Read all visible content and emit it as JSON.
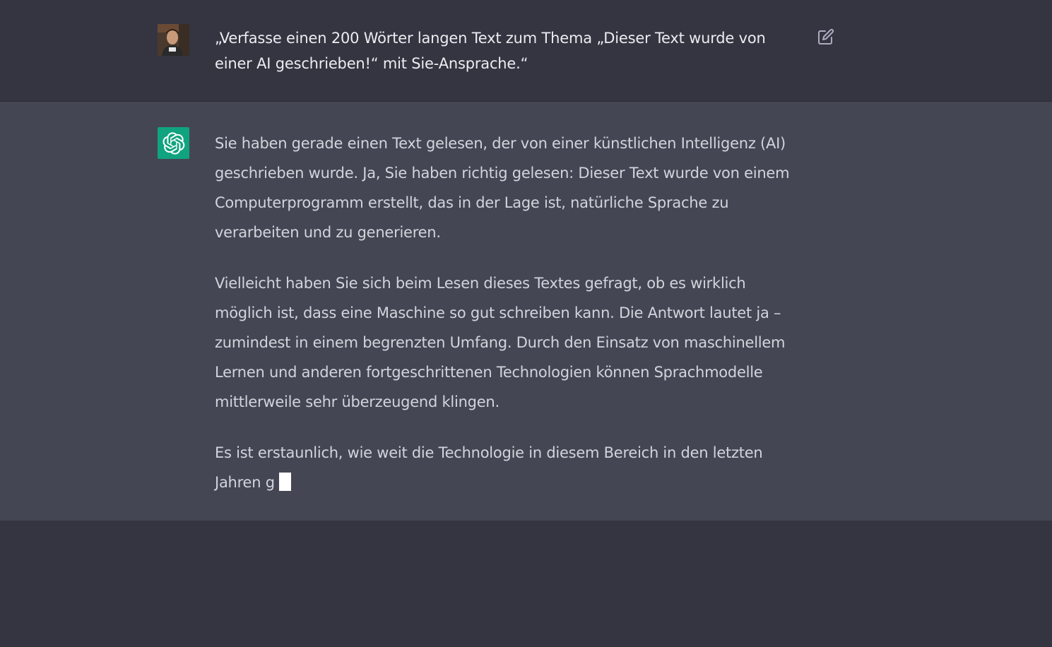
{
  "user_message": {
    "text": "„Verfasse einen 200 Wörter langen Text zum Thema „Dieser Text wurde von einer AI geschrieben!“ mit Sie-Ansprache.“",
    "avatar_icon": "user-avatar-photo",
    "edit_icon": "edit-icon"
  },
  "assistant_message": {
    "avatar_icon": "openai-logo-icon",
    "avatar_color": "#10a37f",
    "paragraphs": [
      "Sie haben gerade einen Text gelesen, der von einer künstlichen Intelligenz (AI) geschrieben wurde. Ja, Sie haben richtig gelesen: Dieser Text wurde von einem Computerprogramm erstellt, das in der Lage ist, natürliche Sprache zu verarbeiten und zu generieren.",
      "Vielleicht haben Sie sich beim Lesen dieses Textes gefragt, ob es wirklich möglich ist, dass eine Maschine so gut schreiben kann. Die Antwort lautet ja – zumindest in einem begrenzten Umfang. Durch den Einsatz von maschinellem Lernen und anderen fortgeschrittenen Technologien können Sprachmodelle mittlerweile sehr überzeugend klingen.",
      "Es ist erstaunlich, wie weit die Technologie in diesem Bereich in den letzten Jahren g"
    ]
  },
  "colors": {
    "background": "#343541",
    "assistant_background": "#444654",
    "user_text": "#ececf1",
    "assistant_text": "#d1d5db"
  }
}
